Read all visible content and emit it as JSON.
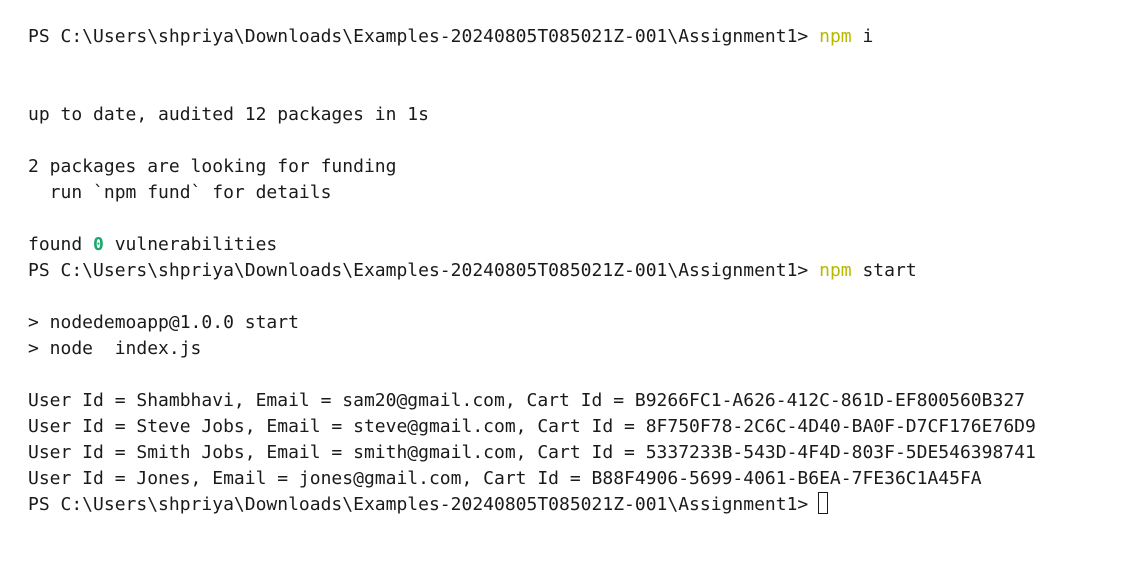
{
  "prompt": "PS C:\\Users\\shpriya\\Downloads\\Examples-20240805T085021Z-001\\Assignment1>",
  "commands": {
    "install": "npm",
    "install_arg": "i",
    "start": "npm",
    "start_arg": "start"
  },
  "install_output": {
    "up_to_date": "up to date, audited 12 packages in 1s",
    "funding_1": "2 packages are looking for funding",
    "funding_2": "  run `npm fund` for details",
    "found_prefix": "found ",
    "found_count": "0",
    "found_suffix": " vulnerabilities"
  },
  "start_output": {
    "line1": "> nodedemoapp@1.0.0 start",
    "line2": "> node  index.js"
  },
  "users": [
    "User Id = Shambhavi, Email = sam20@gmail.com, Cart Id = B9266FC1-A626-412C-861D-EF800560B327",
    "User Id = Steve Jobs, Email = steve@gmail.com, Cart Id = 8F750F78-2C6C-4D40-BA0F-D7CF176E76D9",
    "User Id = Smith Jobs, Email = smith@gmail.com, Cart Id = 5337233B-543D-4F4D-803F-5DE546398741",
    "User Id = Jones, Email = jones@gmail.com, Cart Id = B88F4906-5699-4061-B6EA-7FE36C1A45FA"
  ],
  "colors": {
    "command": "#b8b800",
    "zero_highlight": "#1aa86b",
    "text": "#1a1a1a",
    "background": "#ffffff"
  }
}
